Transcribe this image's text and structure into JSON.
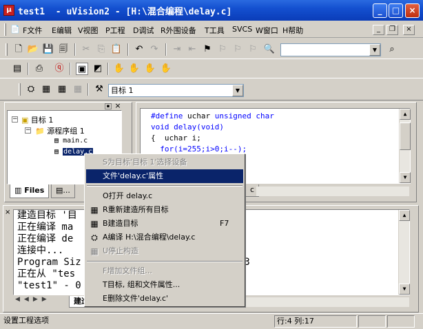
{
  "window": {
    "title": "test1  - uVision2 - [H:\\混合编程\\delay.c]",
    "icon_text": "μ"
  },
  "caption_buttons": {
    "minimize": "_",
    "maximize": "□",
    "close": "×"
  },
  "menu": [
    "F文件",
    "E编辑",
    "V视图",
    "P工程",
    "D调试",
    "R外围设备",
    "T工具",
    "SVCS",
    "W窗口",
    "H帮助"
  ],
  "mdi": {
    "minimize": "_",
    "restore": "❐",
    "close": "×"
  },
  "toolbar": {
    "target_combo": "目标 1",
    "search_combo": ""
  },
  "project": {
    "root": "目标 1",
    "group": "源程序组 1",
    "files": [
      "main.c",
      "delay.c"
    ]
  },
  "editor": {
    "lines": [
      "#define uchar unsigned char",
      "void delay(void)",
      "{  uchar i;",
      "  for(i=255;i>0;i--);"
    ]
  },
  "panel_tabs": {
    "files": "Files",
    "other": "..."
  },
  "output": {
    "lines": [
      "建造目标 '目",
      "正在编译 ma",
      "正在编译 de",
      "连接中...",
      "Program Siz",
      "正在从 \"tes",
      "\"test1\" - 0"
    ],
    "size_tail": "23",
    "tab_label": "建造"
  },
  "context_menu": {
    "items": [
      {
        "label": "S为目标'目标 1'选择设备",
        "disabled": true
      },
      {
        "label": "文件'delay.c'属性",
        "selected": true
      },
      {
        "label": "O打开 delay.c"
      },
      {
        "label": "R重新建造所有目标"
      },
      {
        "label": "B建造目标",
        "shortcut": "F7"
      },
      {
        "label": "A编译 H:\\混合编程\\delay.c"
      },
      {
        "label": "U停止构造",
        "disabled": true
      },
      {
        "label": "F增加文件组...",
        "disabled": true
      },
      {
        "label": "T目标, 组和文件属性..."
      },
      {
        "label": "E删除文件'delay.c'"
      }
    ]
  },
  "status": {
    "message": "设置工程选项",
    "position": "行:4 列:17"
  }
}
